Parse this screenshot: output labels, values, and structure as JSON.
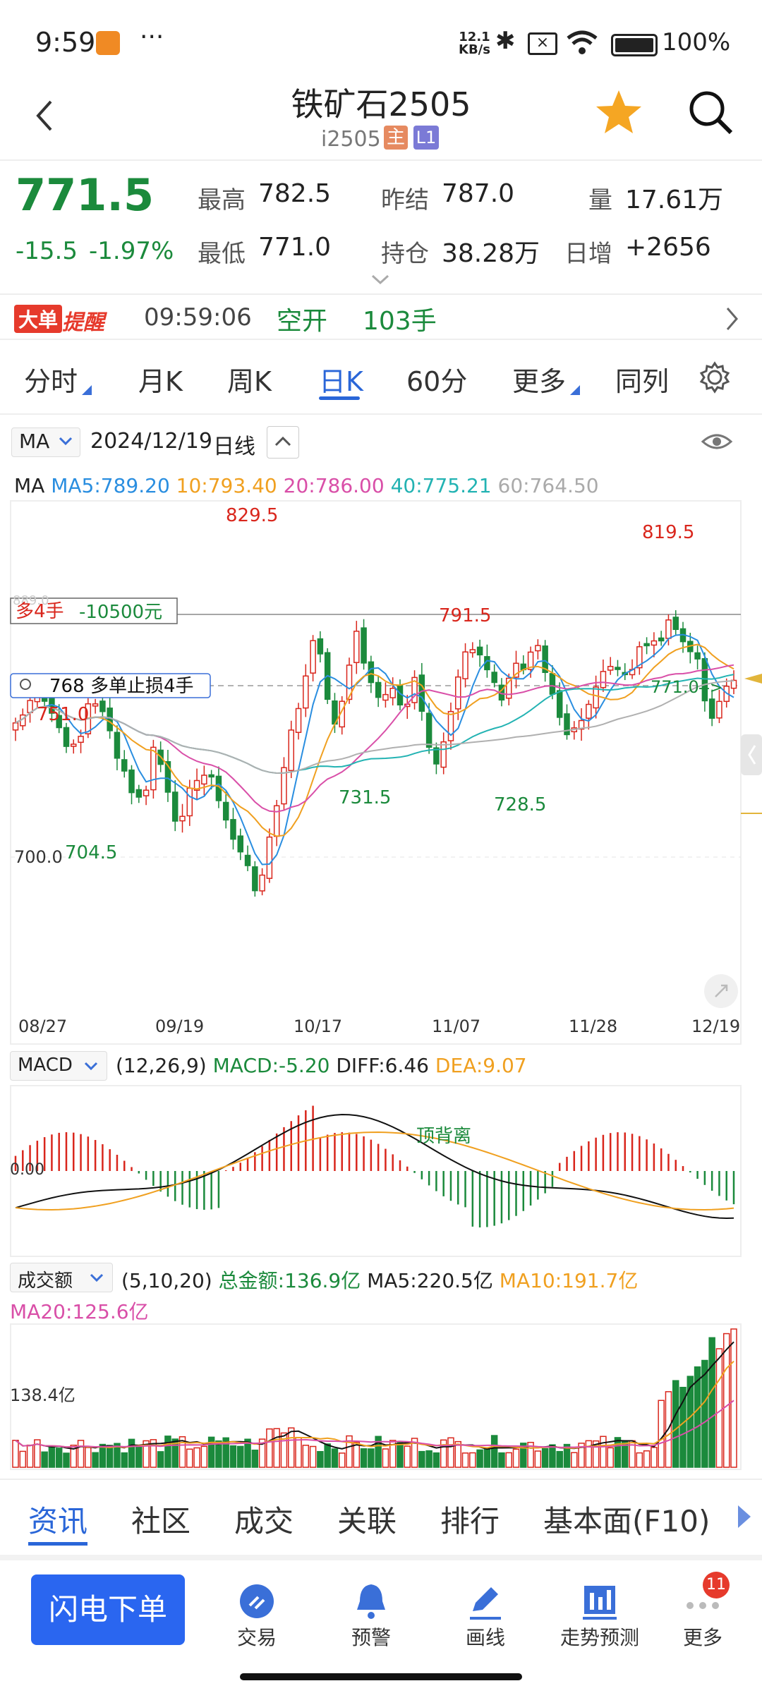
{
  "status": {
    "time": "9:59",
    "dots": "···",
    "net_speed_value": "12.1",
    "net_speed_unit": "KB/s",
    "battery": "100%"
  },
  "header": {
    "title": "铁矿石2505",
    "code": "i2505",
    "badge_main": "主",
    "badge_l1": "L1"
  },
  "quote": {
    "price": "771.5",
    "change": "-15.5",
    "change_pct": "-1.97%",
    "high_label": "最高",
    "high": "782.5",
    "low_label": "最低",
    "low": "771.0",
    "prev_settle_label": "昨结",
    "prev_settle": "787.0",
    "oi_label": "持仓",
    "oi": "38.28万",
    "vol_label": "量",
    "vol": "17.61万",
    "daily_inc_label": "日增",
    "daily_inc": "+2656"
  },
  "alert": {
    "tag_a": "大单",
    "tag_b": "提醒",
    "time": "09:59:06",
    "action": "空开",
    "lots": "103手"
  },
  "ktabs": [
    "分时",
    "月K",
    "周K",
    "日K",
    "60分",
    "更多",
    "同列"
  ],
  "kchart": {
    "indicator": "MA",
    "date": "2024/12/19",
    "period": "日线",
    "ma_label": "MA",
    "ma5": "MA5:789.20",
    "ma10": "10:793.40",
    "ma20": "20:786.00",
    "ma40": "40:775.21",
    "ma60": "60:764.50",
    "position_label": "多4手",
    "position_pnl": "-10500元",
    "position_price_partial": "889.0",
    "stop_price": "768",
    "stop_label": "多单止损4手",
    "labels": {
      "high1": "829.5",
      "high2": "819.5",
      "mid": "791.5",
      "l751": "751.0",
      "l7045": "704.5",
      "l700": "700.0",
      "l7315": "731.5",
      "l7285": "728.5",
      "l771": "771.0"
    },
    "dates": [
      "08/27",
      "09/19",
      "10/17",
      "11/07",
      "11/28",
      "12/19"
    ]
  },
  "macd": {
    "label": "MACD",
    "params": "(12,26,9)",
    "macd": "MACD:-5.20",
    "diff": "DIFF:6.46",
    "dea": "DEA:9.07",
    "axis": "0.00",
    "note": "顶背离"
  },
  "volume": {
    "label": "成交额",
    "params": "(5,10,20)",
    "total": "总金额:136.9亿",
    "ma5": "MA5:220.5亿",
    "ma10": "MA10:191.7亿",
    "ma20": "MA20:125.6亿",
    "axis": "138.4亿"
  },
  "bottom_tabs": [
    "资讯",
    "社区",
    "成交",
    "关联",
    "排行",
    "基本面(F10)"
  ],
  "nav": {
    "order": "闪电下单",
    "trade": "交易",
    "alert": "预警",
    "draw": "画线",
    "trend": "走势预测",
    "more": "更多",
    "more_badge": "11"
  },
  "chart_data": {
    "type": "candlestick",
    "x_range": [
      "08/27",
      "12/19"
    ],
    "y_marks": {
      "highest": 829.5,
      "recent_high": 819.5,
      "mid_high": 791.5,
      "low_a": 704.5,
      "low_b": 731.5,
      "low_c": 728.5,
      "last": 771.0
    },
    "ma": {
      "MA5": 789.2,
      "MA10": 793.4,
      "MA20": 786.0,
      "MA40": 775.21,
      "MA60": 764.5
    },
    "macd": {
      "MACD": -5.2,
      "DIFF": 6.46,
      "DEA": 9.07
    },
    "turnover": {
      "total": "136.9亿",
      "MA5": "220.5亿",
      "MA10": "191.7亿",
      "MA20": "125.6亿"
    }
  }
}
